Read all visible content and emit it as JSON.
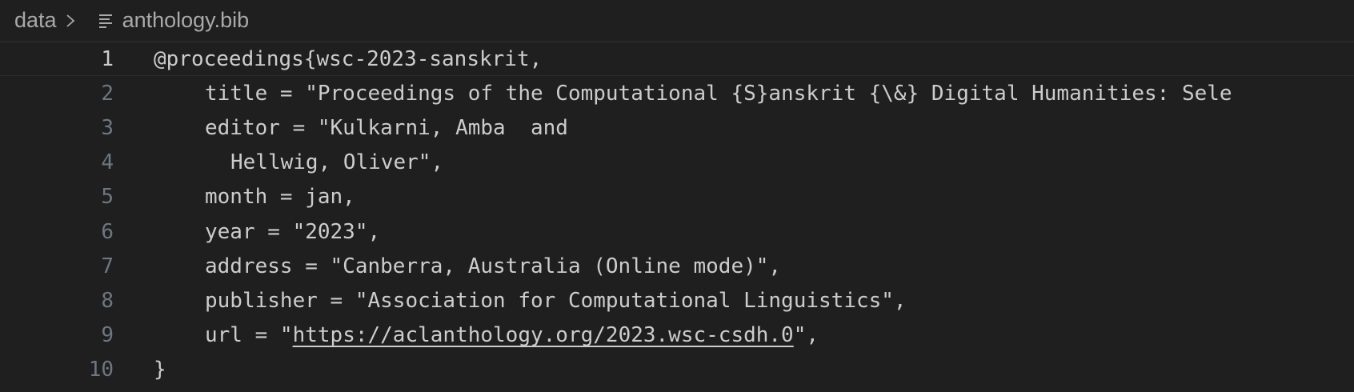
{
  "breadcrumb": {
    "folder": "data",
    "file": "anthology.bib"
  },
  "colors": {
    "background": "#1f1f1f",
    "text": "#cccccc",
    "line_number": "#6e7681",
    "line_number_active": "#cccccc"
  },
  "editor": {
    "lines": [
      {
        "number": "1",
        "text": "@proceedings{wsc-2023-sanskrit,"
      },
      {
        "number": "2",
        "text": "title = \"Proceedings of the Computational {S}anskrit {\\&} Digital Humanities: Sele"
      },
      {
        "number": "3",
        "text": "editor = \"Kulkarni, Amba  and"
      },
      {
        "number": "4",
        "text": "Hellwig, Oliver\","
      },
      {
        "number": "5",
        "text": "month = jan,"
      },
      {
        "number": "6",
        "text": "year = \"2023\","
      },
      {
        "number": "7",
        "text": "address = \"Canberra, Australia (Online mode)\","
      },
      {
        "number": "8",
        "text": "publisher = \"Association for Computational Linguistics\","
      },
      {
        "number": "9",
        "prefix": "url = \"",
        "link": "https://aclanthology.org/2023.wsc-csdh.0",
        "suffix": "\","
      },
      {
        "number": "10",
        "text": "}"
      }
    ]
  }
}
